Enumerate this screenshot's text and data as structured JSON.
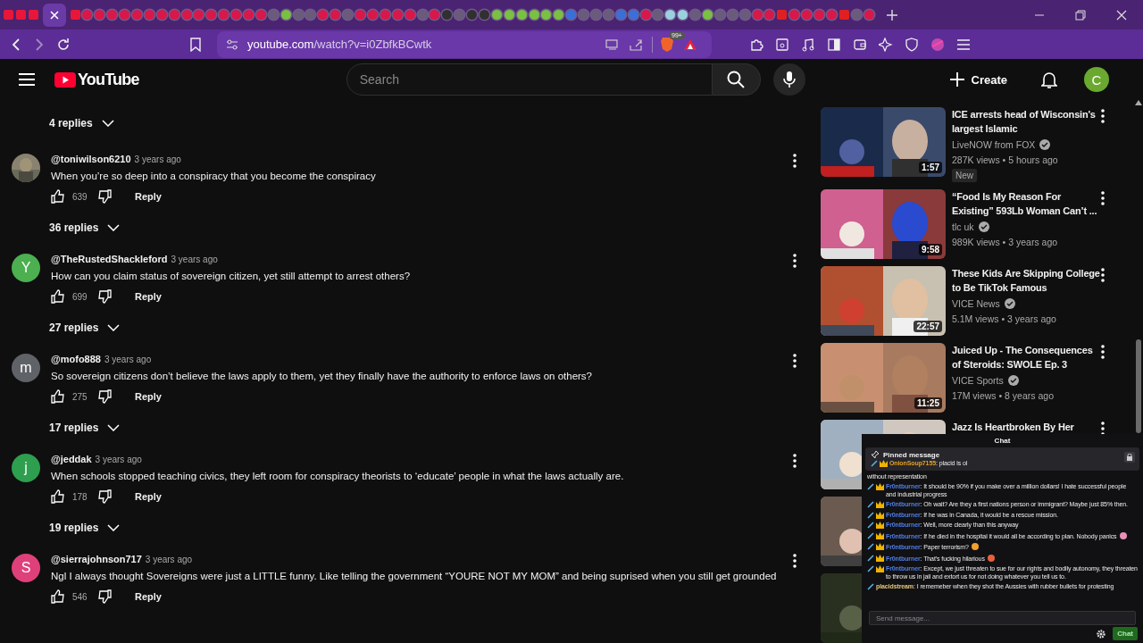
{
  "browser": {
    "url_host": "youtube.com",
    "url_path": "/watch?v=i0ZbfkBCwtk",
    "shield_badge": "99+"
  },
  "header": {
    "logo": "YouTube",
    "search": {
      "placeholder": "Search"
    },
    "create": "Create",
    "avatar": "C"
  },
  "comments": {
    "top_replies": "4 replies",
    "items": [
      {
        "author": "@toniwilson6210",
        "time": "3 years ago",
        "text": "When you’re so deep into a conspiracy that you become the conspiracy",
        "likes": "639",
        "reply": "Reply",
        "replies": "36 replies",
        "avatar": {
          "kind": "picture"
        }
      },
      {
        "author": "@TheRustedShackleford",
        "time": "3 years ago",
        "text": "How can you claim status of sovereign citizen, yet still attempt to arrest others?",
        "likes": "699",
        "reply": "Reply",
        "replies": "27 replies",
        "avatar": {
          "kind": "letter",
          "letter": "Y",
          "color": "#4caf50"
        }
      },
      {
        "author": "@mofo888",
        "time": "3 years ago",
        "text": "So sovereign citizens don’t believe the laws apply to them, yet they finally have the authority to enforce laws on others?",
        "likes": "275",
        "reply": "Reply",
        "replies": "17 replies",
        "avatar": {
          "kind": "letter",
          "letter": "m",
          "color": "#5f6368"
        }
      },
      {
        "author": "@jeddak",
        "time": "3 years ago",
        "text": "When schools stopped teaching civics, they left room for conspiracy theorists to ‘educate’ people in what the laws actually are.",
        "likes": "178",
        "reply": "Reply",
        "replies": "19 replies",
        "avatar": {
          "kind": "letter",
          "letter": "j",
          "color": "#2e9e4f"
        }
      },
      {
        "author": "@sierrajohnson717",
        "time": "3 years ago",
        "text": "Ngl I always thought Sovereigns were just a LITTLE funny. Like telling the government “YOURE NOT MY MOM” and being suprised when you still get grounded",
        "likes": "546",
        "reply": "Reply",
        "avatar": {
          "kind": "letter",
          "letter": "S",
          "color": "#e0407a"
        }
      }
    ]
  },
  "sidebar": {
    "videos": [
      {
        "kind": "video",
        "title": "ICE arrests head of Wisconsin's largest Islamic",
        "channel": "LiveNOW from FOX",
        "verified": true,
        "meta": "287K views • 5 hours ago",
        "badge": "New",
        "duration": "1:57"
      },
      {
        "kind": "video",
        "title": "“Food Is My Reason For Existing” 593Lb Woman Can’t ...",
        "channel": "tlc uk",
        "verified": true,
        "meta": "989K views • 3 years ago",
        "duration": "9:58"
      },
      {
        "kind": "video",
        "title": "These Kids Are Skipping College to Be TikTok Famous",
        "channel": "VICE News",
        "verified": true,
        "meta": "5.1M views • 3 years ago",
        "duration": "22:57"
      },
      {
        "kind": "video",
        "title": "Juiced Up - The Consequences of Steroids: SWOLE Ep. 3",
        "channel": "VICE Sports",
        "verified": true,
        "meta": "17M views • 8 years ago",
        "duration": "11:25"
      },
      {
        "kind": "video",
        "title": "Jazz Is Heartbroken By Her"
      },
      {
        "kind": "picture"
      },
      {
        "kind": "picture"
      }
    ]
  },
  "chat": {
    "title": "Chat",
    "pinned": {
      "label": "Pinned message",
      "user": "OnionSoup7155",
      "text": ": placid is ol"
    },
    "messages": [
      {
        "text": "without representation",
        "kind": "plain"
      },
      {
        "badges": [
          {
            "kind": "sword"
          },
          {
            "kind": "crown"
          }
        ],
        "user": "Fr0ntburner",
        "color": "#4f7ee8",
        "text": ": It should be 90% if you make over a million dollars! I hate successful people and industrial progress",
        "kind": "message"
      },
      {
        "badges": [
          {
            "kind": "sword"
          },
          {
            "kind": "crown"
          }
        ],
        "user": "Fr0ntburner",
        "color": "#4f7ee8",
        "text": ": Oh wait? Are they a first nations person or immigrant? Maybe just 85% then.",
        "kind": "message"
      },
      {
        "badges": [
          {
            "kind": "sword"
          },
          {
            "kind": "crown"
          }
        ],
        "user": "Fr0ntburner",
        "color": "#4f7ee8",
        "text": ": If he was in Canada, it would be a rescue mission.",
        "kind": "message"
      },
      {
        "badges": [
          {
            "kind": "sword"
          },
          {
            "kind": "crown"
          }
        ],
        "user": "Fr0ntburner",
        "color": "#4f7ee8",
        "text": ": Well, more clearly than this anyway",
        "kind": "message"
      },
      {
        "badges": [
          {
            "kind": "sword"
          },
          {
            "kind": "crown"
          }
        ],
        "user": "Fr0ntburner",
        "color": "#4f7ee8",
        "text": ": If he died in the hospital it would all be according to plan. Nobody panics",
        "kind": "message",
        "emoji": {
          "color": "#e890b8"
        }
      },
      {
        "badges": [
          {
            "kind": "sword"
          },
          {
            "kind": "crown"
          }
        ],
        "user": "Fr0ntburner",
        "color": "#4f7ee8",
        "text": ": Paper terrorism?",
        "kind": "message",
        "emoji": {
          "color": "#f0a030"
        }
      },
      {
        "badges": [
          {
            "kind": "sword"
          },
          {
            "kind": "crown"
          }
        ],
        "user": "Fr0ntburner",
        "color": "#4f7ee8",
        "text": ": That’s fucking hilarious",
        "kind": "message",
        "emoji": {
          "color": "#e8603a"
        }
      },
      {
        "badges": [
          {
            "kind": "sword"
          },
          {
            "kind": "crown"
          }
        ],
        "user": "Fr0ntburner",
        "color": "#4f7ee8",
        "text": ": Except, we just threaten to sue for our rights and bodily autonomy, they threaten to throw us in jail and extort us for not doing whatever you tell us to.",
        "kind": "message"
      },
      {
        "badges": [
          {
            "kind": "sword"
          }
        ],
        "user": "placidstream",
        "color": "#e8c87a",
        "text": ": I rememeber when they shot the Aussies with rubber bullets for protesting",
        "kind": "message"
      }
    ],
    "input": {
      "placeholder": "Send message..."
    },
    "send": "Chat"
  }
}
